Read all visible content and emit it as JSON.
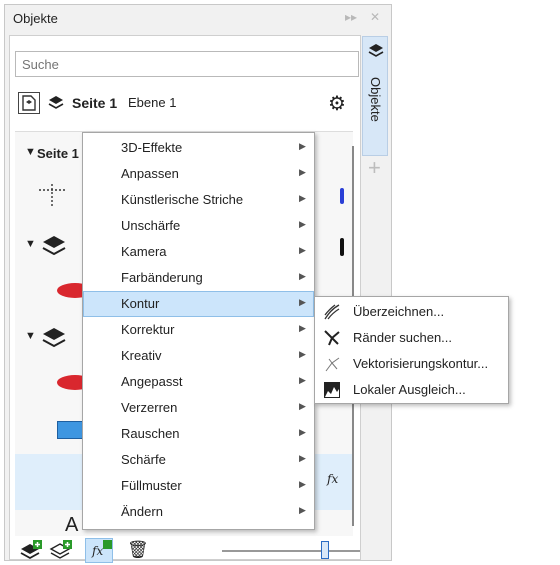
{
  "panel": {
    "title": "Objekte",
    "search_placeholder": "Suche",
    "page_label": "Seite 1",
    "layer_label": "Ebene 1",
    "tree_page_label": "Seite 1",
    "side_tab_label": "Objekte",
    "fx_label": "fx",
    "slider_level": 0.75
  },
  "menu": {
    "items": [
      {
        "label": "3D-Effekte"
      },
      {
        "label": "Anpassen"
      },
      {
        "label": "Künstlerische Striche"
      },
      {
        "label": "Unschärfe"
      },
      {
        "label": "Kamera"
      },
      {
        "label": "Farbänderung"
      },
      {
        "label": "Kontur"
      },
      {
        "label": "Korrektur"
      },
      {
        "label": "Kreativ"
      },
      {
        "label": "Angepasst"
      },
      {
        "label": "Verzerren"
      },
      {
        "label": "Rauschen"
      },
      {
        "label": "Schärfe"
      },
      {
        "label": "Füllmuster"
      },
      {
        "label": "Ändern"
      }
    ],
    "highlighted": "Kontur"
  },
  "submenu": {
    "items": [
      {
        "label": "Überzeichnen...",
        "icon": "overdraw-icon"
      },
      {
        "label": "Ränder suchen...",
        "icon": "find-edges-icon"
      },
      {
        "label": "Vektorisierungskontur...",
        "icon": "trace-contour-icon"
      },
      {
        "label": "Lokaler Ausgleich...",
        "icon": "local-equalization-icon"
      }
    ]
  },
  "colors": {
    "accent_blue": "#3e96e1",
    "red_ellipse": "#d9272e",
    "highlight": "#cce5fb"
  }
}
